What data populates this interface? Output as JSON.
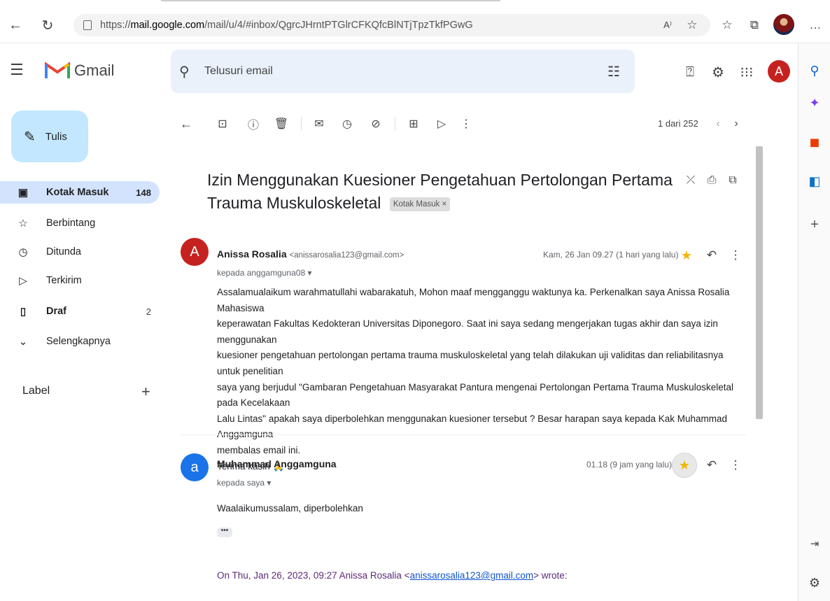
{
  "browser": {
    "url_prefix": "https://",
    "url_host": "mail.google.com",
    "url_path": "/mail/u/4/#inbox/QgrcJHrntPTGlrCFKQfcBlNTjTpzTkfPGwG",
    "read_aloud": "A⁾",
    "more": "…"
  },
  "gmail": {
    "brand": "Gmail",
    "search_placeholder": "Telusuri email",
    "avatar_letter": "A"
  },
  "nav": {
    "compose": "Tulis",
    "items": [
      {
        "label": "Kotak Masuk",
        "count": "148"
      },
      {
        "label": "Berbintang",
        "count": ""
      },
      {
        "label": "Ditunda",
        "count": ""
      },
      {
        "label": "Terkirim",
        "count": ""
      },
      {
        "label": "Draf",
        "count": "2"
      },
      {
        "label": "Selengkapnya",
        "count": ""
      }
    ],
    "label_header": "Label"
  },
  "toolbar": {
    "pager": "1 dari 252"
  },
  "email": {
    "subject": "Izin Menggunakan Kuesioner Pengetahuan Pertolongan Pertama Trauma Muskuloskeletal",
    "tag": "Kotak Masuk ×",
    "messages": [
      {
        "avatar": "A",
        "avatar_color": "#c5221f",
        "sender_name": "Anissa Rosalia",
        "sender_email": "<anissarosalia123@gmail.com>",
        "to": "kepada anggamguna08 ▾",
        "date": "Kam, 26 Jan 09.27 (1 hari yang lalu)",
        "body": [
          "Assalamualaikum warahmatullahi wabarakatuh, Mohon maaf mengganggu waktunya ka. Perkenalkan saya Anissa Rosalia Mahasiswa",
          "keperawatan Fakultas Kedokteran Universitas Diponegoro. Saat ini saya sedang mengerjakan tugas akhir dan saya izin menggunakan",
          "kuesioner pengetahuan pertolongan pertama trauma muskuloskeletal yang telah dilakukan uji validitas dan reliabilitasnya untuk penelitian",
          "saya yang berjudul \"Gambaran Pengetahuan Masyarakat Pantura mengenai Pertolongan Pertama Trauma Muskuloskeletal pada Kecelakaan",
          "Lalu Lintas\" apakah saya diperbolehkan menggunakan kuesioner tersebut ? Besar harapan saya kepada Kak Muhammad Anggamguna",
          "membalas email ini.",
          "Terima kasih 🙏"
        ]
      },
      {
        "avatar": "a",
        "avatar_color": "#1a73e8",
        "sender_name": "Muhammad Anggamguna",
        "to": "kepada saya ▾",
        "date": "01.18 (9 jam yang lalu)",
        "body": [
          "Waalaikumussalam, diperbolehkan"
        ],
        "ellipsis": "•••",
        "quote_prefix": "On Thu, Jan 26, 2023, 09:27 Anissa Rosalia <",
        "quote_link": "anissarosalia123@gmail.com",
        "quote_suffix": "> wrote:"
      }
    ]
  }
}
